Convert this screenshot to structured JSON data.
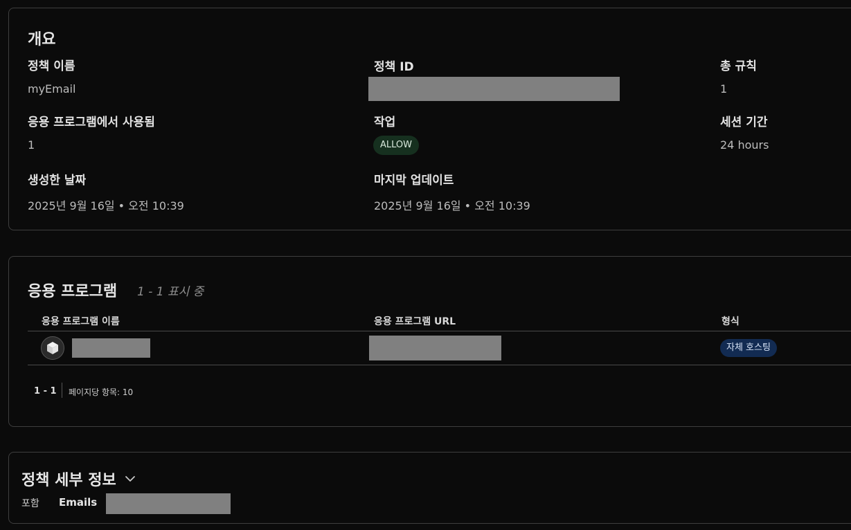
{
  "overview": {
    "title": "개요",
    "policy_name_label": "정책 이름",
    "policy_name_value": "myEmail",
    "policy_id_label": "정책 ID",
    "total_rules_label": "총 규칙",
    "total_rules_value": "1",
    "used_in_apps_label": "응용 프로그램에서 사용됨",
    "used_in_apps_value": "1",
    "action_label": "작업",
    "action_value": "ALLOW",
    "session_duration_label": "세션 기간",
    "session_duration_value": "24 hours",
    "created_label": "생성한 날짜",
    "created_value": "2025년 9월 16일 • 오전 10:39",
    "updated_label": "마지막 업데이트",
    "updated_value": "2025년 9월 16일 • 오전 10:39"
  },
  "applications": {
    "title": "응용 프로그램",
    "count_text": "1 - 1 표시 중",
    "columns": [
      "응용 프로그램 이름",
      "응용 프로그램 URL",
      "형식"
    ],
    "rows": [
      {
        "type": "자체 호스팅"
      }
    ],
    "pager_range": "1 - 1",
    "pager_per_page": "페이지당 항목: 10"
  },
  "details": {
    "title": "정책 세부 정보",
    "include_label": "포함",
    "include_type": "Emails"
  },
  "colors": {
    "background": "#0b0b0b",
    "allow_badge": "#16301f",
    "type_badge": "#122b52",
    "redaction": "#808080"
  },
  "icons": {
    "app_avatar": "cube-icon",
    "details_toggle": "chevron-down-icon"
  }
}
